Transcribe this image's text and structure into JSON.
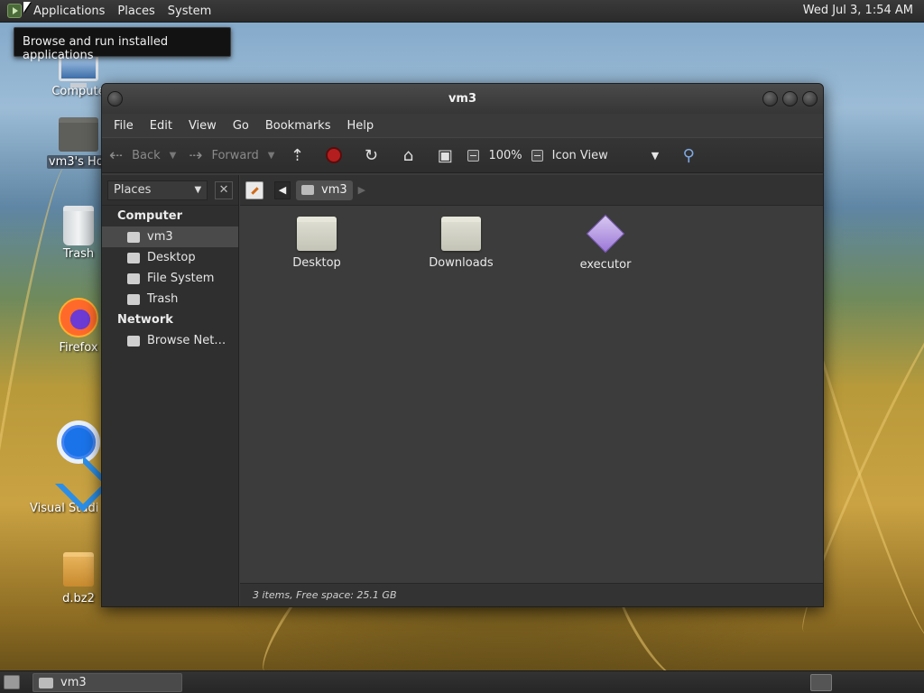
{
  "top_panel": {
    "menus": [
      "Applications",
      "Places",
      "System"
    ],
    "clock": "Wed Jul  3,  1:54 AM"
  },
  "tooltip": "Browse and run installed applications",
  "desktop_icons": [
    {
      "label": "Compute",
      "icon": "computer-icon"
    },
    {
      "label": "vm3's Hor",
      "icon": "home-folder-icon"
    },
    {
      "label": "Trash",
      "icon": "trash-icon"
    },
    {
      "label": "Firefox",
      "icon": "firefox-icon"
    },
    {
      "label": "Visual Studio",
      "icon": "vscode-icon"
    },
    {
      "label": "d.bz2",
      "icon": "archive-icon"
    }
  ],
  "window": {
    "title": "vm3",
    "menubar": [
      "File",
      "Edit",
      "View",
      "Go",
      "Bookmarks",
      "Help"
    ],
    "toolbar": {
      "back": "Back",
      "forward": "Forward",
      "zoom": "100%",
      "view_mode": "Icon View"
    },
    "sidebar": {
      "selector": "Places",
      "groups": [
        {
          "title": "Computer",
          "items": [
            "vm3",
            "Desktop",
            "File System",
            "Trash"
          ]
        },
        {
          "title": "Network",
          "items": [
            "Browse Net…"
          ]
        }
      ]
    },
    "pathbar": {
      "crumb": "vm3"
    },
    "files": [
      {
        "name": "Desktop",
        "type": "folder"
      },
      {
        "name": "Downloads",
        "type": "folder"
      },
      {
        "name": "executor",
        "type": "executable"
      }
    ],
    "status": "3 items, Free space: 25.1 GB"
  },
  "bottom_panel": {
    "task": "vm3"
  }
}
